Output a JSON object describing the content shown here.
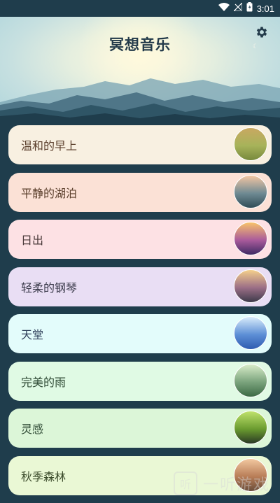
{
  "status_bar": {
    "time": "3:01"
  },
  "header": {
    "title": "冥想音乐"
  },
  "tracks": [
    {
      "label": "温和的早上",
      "card_color": "#f8f0e1",
      "text_color": "#5a3e2b",
      "thumb_colors": [
        "#c9a861",
        "#a7b35a",
        "#77893c"
      ]
    },
    {
      "label": "平静的湖泊",
      "card_color": "#fbe1d6",
      "text_color": "#5a3e2b",
      "thumb_colors": [
        "#f4c6a3",
        "#6f8a93",
        "#2f4c57"
      ]
    },
    {
      "label": "日出",
      "card_color": "#fde1e4",
      "text_color": "#4a3a3a",
      "thumb_colors": [
        "#f8c26b",
        "#a95a9b",
        "#3f2a63"
      ]
    },
    {
      "label": "轻柔的钢琴",
      "card_color": "#e9def4",
      "text_color": "#3a3a4a",
      "thumb_colors": [
        "#f4cf8c",
        "#9b6e86",
        "#3d3a4a"
      ]
    },
    {
      "label": "天堂",
      "card_color": "#e3fcfb",
      "text_color": "#2f3f5a",
      "thumb_colors": [
        "#d9ecfb",
        "#5d8fd6",
        "#2f5cb1"
      ]
    },
    {
      "label": "完美的雨",
      "card_color": "#e0fae4",
      "text_color": "#2f4a35",
      "thumb_colors": [
        "#d8ecc8",
        "#7aa37c",
        "#3c6a45"
      ]
    },
    {
      "label": "灵感",
      "card_color": "#dcf6d8",
      "text_color": "#2f4a35",
      "thumb_colors": [
        "#bfe26c",
        "#6a9b2f",
        "#2a3a25"
      ]
    },
    {
      "label": "秋季森林",
      "card_color": "#eaf8d5",
      "text_color": "#3a4a2a",
      "thumb_colors": [
        "#f2c8a0",
        "#b87d57",
        "#6a4d3a"
      ]
    }
  ],
  "watermark": {
    "icon_char": "听",
    "text": "一听游戏"
  }
}
